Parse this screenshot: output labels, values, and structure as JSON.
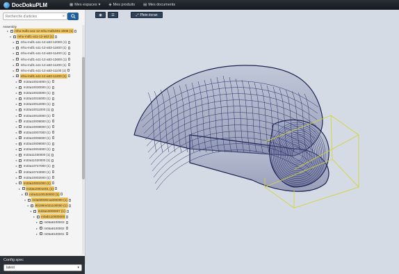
{
  "app": {
    "brand": "DocDokuPLM"
  },
  "nav": [
    {
      "label": "Mes espaces",
      "icon": "grid-icon",
      "caret": "▾"
    },
    {
      "label": "Mes produits",
      "icon": "cube-icon",
      "caret": ""
    },
    {
      "label": "Mes documents",
      "icon": "file-icon",
      "caret": ""
    }
  ],
  "search": {
    "placeholder": "Recherche d'articles",
    "button_icon": "search-icon"
  },
  "tree": {
    "root": "Assembly",
    "nodes": [
      {
        "label": "mhu-mdl1-a11-12-mhu-mdl1001-2006 (1)",
        "level": 1,
        "hl": true
      },
      {
        "label": "mhu-mdl1-a11-12-a53 (1)",
        "level": 2,
        "hl": true
      },
      {
        "label": "mhu-mdl1-a11-12-a53-12000 (1)",
        "level": 3,
        "hl": false
      },
      {
        "label": "mhu-mdl1-a11-12-a53-11600 (1)",
        "level": 3,
        "hl": false
      },
      {
        "label": "mhu-mdl1-a11-12-a53-11400 (1)",
        "level": 3,
        "hl": false
      },
      {
        "label": "mhu-mdl1-a11-12-a53-13600 (1)",
        "level": 3,
        "hl": false
      },
      {
        "label": "mhu-mdl1-a11-12-a53-11200 (1)",
        "level": 3,
        "hl": false
      },
      {
        "label": "mhu-mdl1-a11-12-a53-11100 (1)",
        "level": 3,
        "hl": false
      },
      {
        "label": "mhu-mdl1-a11-12-a53-11200 (1)",
        "level": 3,
        "hl": true
      },
      {
        "label": "m33a10024000 (1)",
        "level": 4,
        "hl": false
      },
      {
        "label": "m33a10030000 (1)",
        "level": 4,
        "hl": false
      },
      {
        "label": "m33a10033000 (1)",
        "level": 4,
        "hl": false
      },
      {
        "label": "m33a10015000 (1)",
        "level": 4,
        "hl": false
      },
      {
        "label": "m33a10012000 (1)",
        "level": 4,
        "hl": false
      },
      {
        "label": "m33a10011000 (1)",
        "level": 4,
        "hl": false
      },
      {
        "label": "m33a10010000 (1)",
        "level": 4,
        "hl": false
      },
      {
        "label": "m33a10009000 (1)",
        "level": 4,
        "hl": false
      },
      {
        "label": "m33a10008000 (1)",
        "level": 4,
        "hl": false
      },
      {
        "label": "m33a10007000 (1)",
        "level": 4,
        "hl": false
      },
      {
        "label": "m33a10006000 (1)",
        "level": 4,
        "hl": false
      },
      {
        "label": "m33a10009000 (1)",
        "level": 4,
        "hl": false
      },
      {
        "label": "m33a10004000 (1)",
        "level": 4,
        "hl": false
      },
      {
        "label": "m33a11030000 (1)",
        "level": 4,
        "hl": false
      },
      {
        "label": "m33a11020000 (1)",
        "level": 4,
        "hl": false
      },
      {
        "label": "m33a10747000 (1)",
        "level": 4,
        "hl": false
      },
      {
        "label": "m33a10743000 (1)",
        "level": 4,
        "hl": false
      },
      {
        "label": "m33a10002000 (1)",
        "level": 4,
        "hl": false
      },
      {
        "label": "m33a10001000 (1)",
        "level": 4,
        "hl": true
      },
      {
        "label": "m33a10001001 (1)",
        "level": 5,
        "hl": true
      },
      {
        "label": "m0a11100100000 (1)",
        "level": 6,
        "hl": true
      },
      {
        "label": "m0a00000ma000000 (1)",
        "level": 7,
        "hl": true
      },
      {
        "label": "80198m021100000 (1)",
        "level": 8,
        "hl": true
      },
      {
        "label": "m33a10000007 (1)",
        "level": 9,
        "hl": true
      },
      {
        "label": "m0ab110000000",
        "level": 10,
        "hl": true
      },
      {
        "label": "m05a9100003",
        "level": 11,
        "hl": false
      },
      {
        "label": "m05a9100002",
        "level": 11,
        "hl": false
      },
      {
        "label": "m05a9100001",
        "level": 11,
        "hl": false
      }
    ]
  },
  "config": {
    "title": "Config spec",
    "selected": "latest"
  },
  "toolbar": {
    "more_filters": "Plein écran"
  }
}
